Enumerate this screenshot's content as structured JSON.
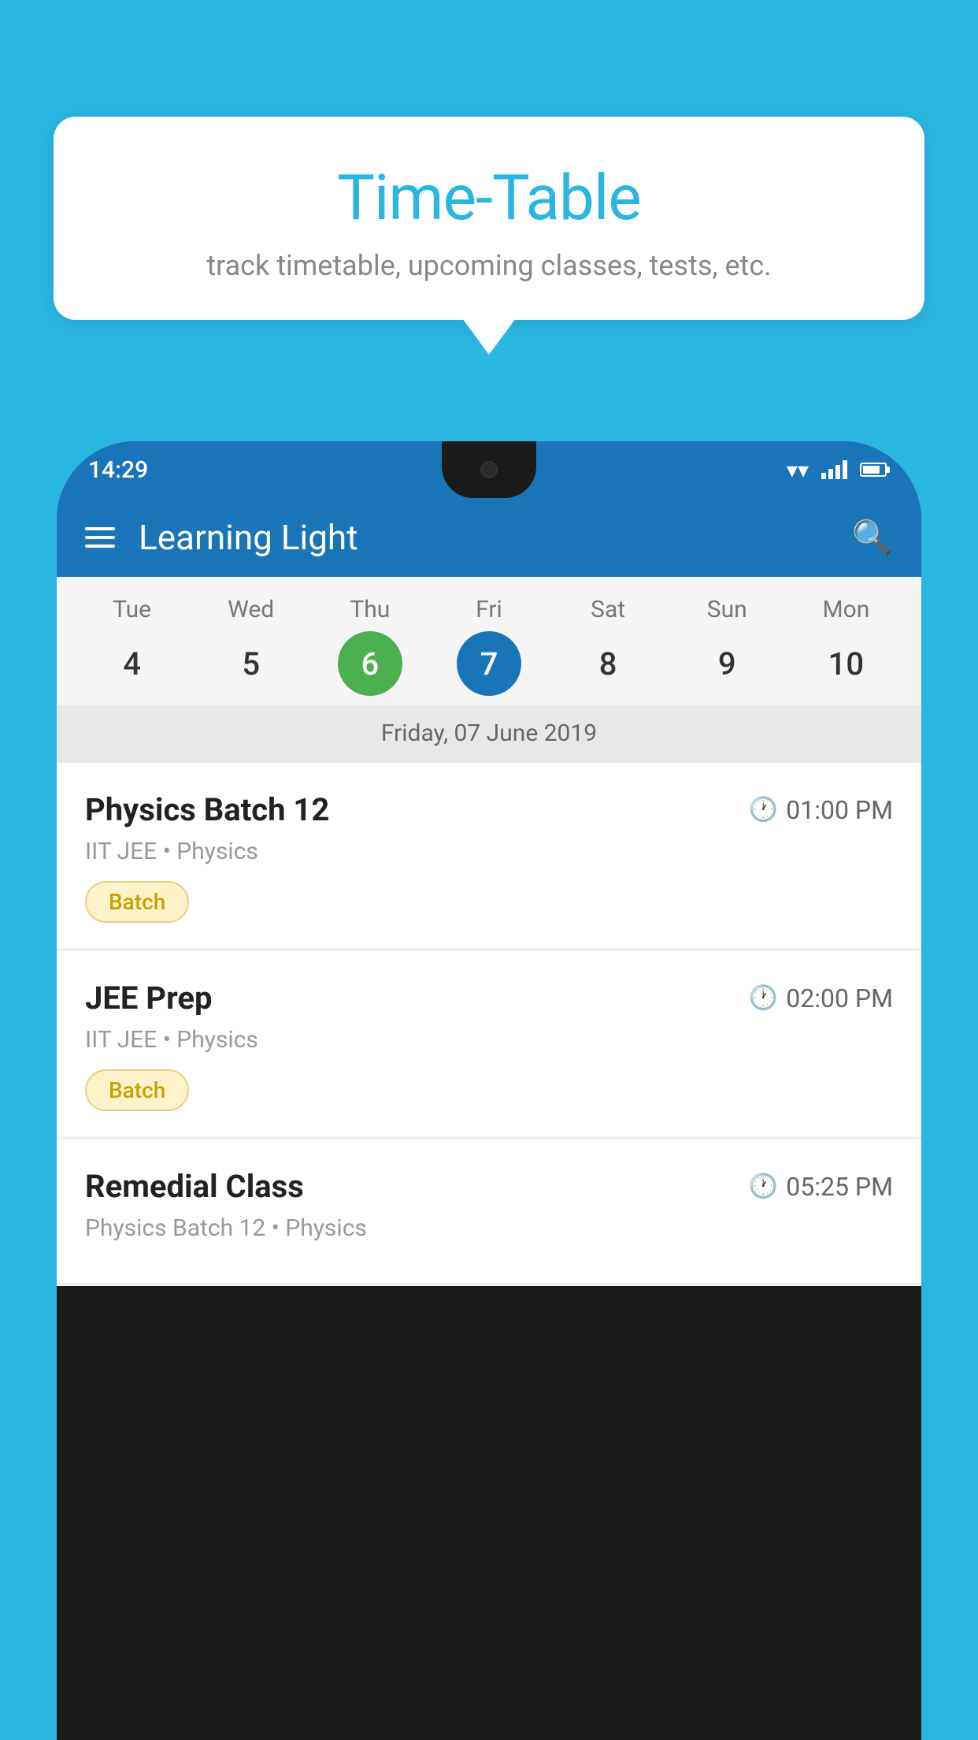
{
  "background_color": "#29B6E0",
  "tooltip": {
    "title": "Time-Table",
    "subtitle": "track timetable, upcoming classes, tests, etc."
  },
  "phone": {
    "status_bar": {
      "time": "14:29"
    },
    "app_bar": {
      "title": "Learning Light"
    },
    "calendar": {
      "days": [
        {
          "name": "Tue",
          "num": "4",
          "state": "normal"
        },
        {
          "name": "Wed",
          "num": "5",
          "state": "normal"
        },
        {
          "name": "Thu",
          "num": "6",
          "state": "today"
        },
        {
          "name": "Fri",
          "num": "7",
          "state": "selected"
        },
        {
          "name": "Sat",
          "num": "8",
          "state": "normal"
        },
        {
          "name": "Sun",
          "num": "9",
          "state": "normal"
        },
        {
          "name": "Mon",
          "num": "10",
          "state": "normal"
        }
      ],
      "selected_date_label": "Friday, 07 June 2019"
    },
    "classes": [
      {
        "name": "Physics Batch 12",
        "time": "01:00 PM",
        "meta": "IIT JEE • Physics",
        "badge": "Batch"
      },
      {
        "name": "JEE Prep",
        "time": "02:00 PM",
        "meta": "IIT JEE • Physics",
        "badge": "Batch"
      },
      {
        "name": "Remedial Class",
        "time": "05:25 PM",
        "meta": "Physics Batch 12 • Physics",
        "badge": null
      }
    ]
  }
}
